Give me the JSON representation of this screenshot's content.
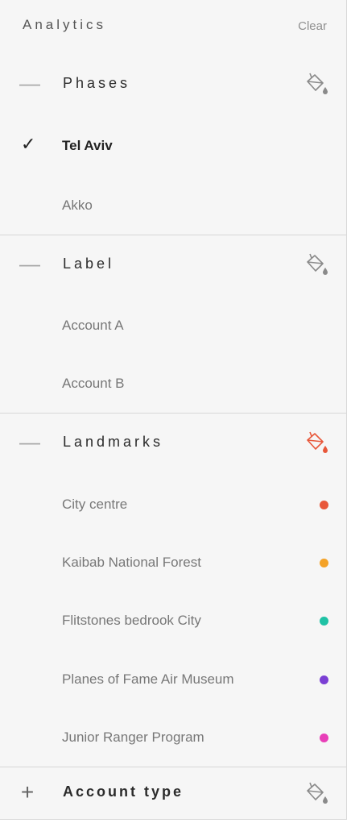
{
  "panel": {
    "title": "Analytics",
    "clear_label": "Clear"
  },
  "sections": [
    {
      "toggle": "—",
      "label": "Phases",
      "icon": "paint-bucket-icon",
      "icon_color": "#888888",
      "items": [
        {
          "label": "Tel Aviv",
          "selected": true,
          "check": "✓"
        },
        {
          "label": "Akko",
          "selected": false
        }
      ]
    },
    {
      "toggle": "—",
      "label": "Label",
      "icon": "paint-bucket-icon",
      "icon_color": "#888888",
      "items": [
        {
          "label": "Account A",
          "selected": false
        },
        {
          "label": "Account B",
          "selected": false
        }
      ]
    },
    {
      "toggle": "—",
      "label": "Landmarks",
      "icon": "paint-bucket-icon",
      "icon_color": "#e8573a",
      "items": [
        {
          "label": "City centre",
          "color": "#e8573a"
        },
        {
          "label": "Kaibab National Forest",
          "color": "#f4a227"
        },
        {
          "label": "Flitstones bedrook City",
          "color": "#1fc2a5"
        },
        {
          "label": "Planes of Fame Air Museum",
          "color": "#7b3fd4"
        },
        {
          "label": "Junior Ranger Program",
          "color": "#e83fb8"
        }
      ]
    },
    {
      "toggle": "+",
      "label": "Account type",
      "icon": "paint-bucket-icon",
      "icon_color": "#888888",
      "items": []
    }
  ]
}
